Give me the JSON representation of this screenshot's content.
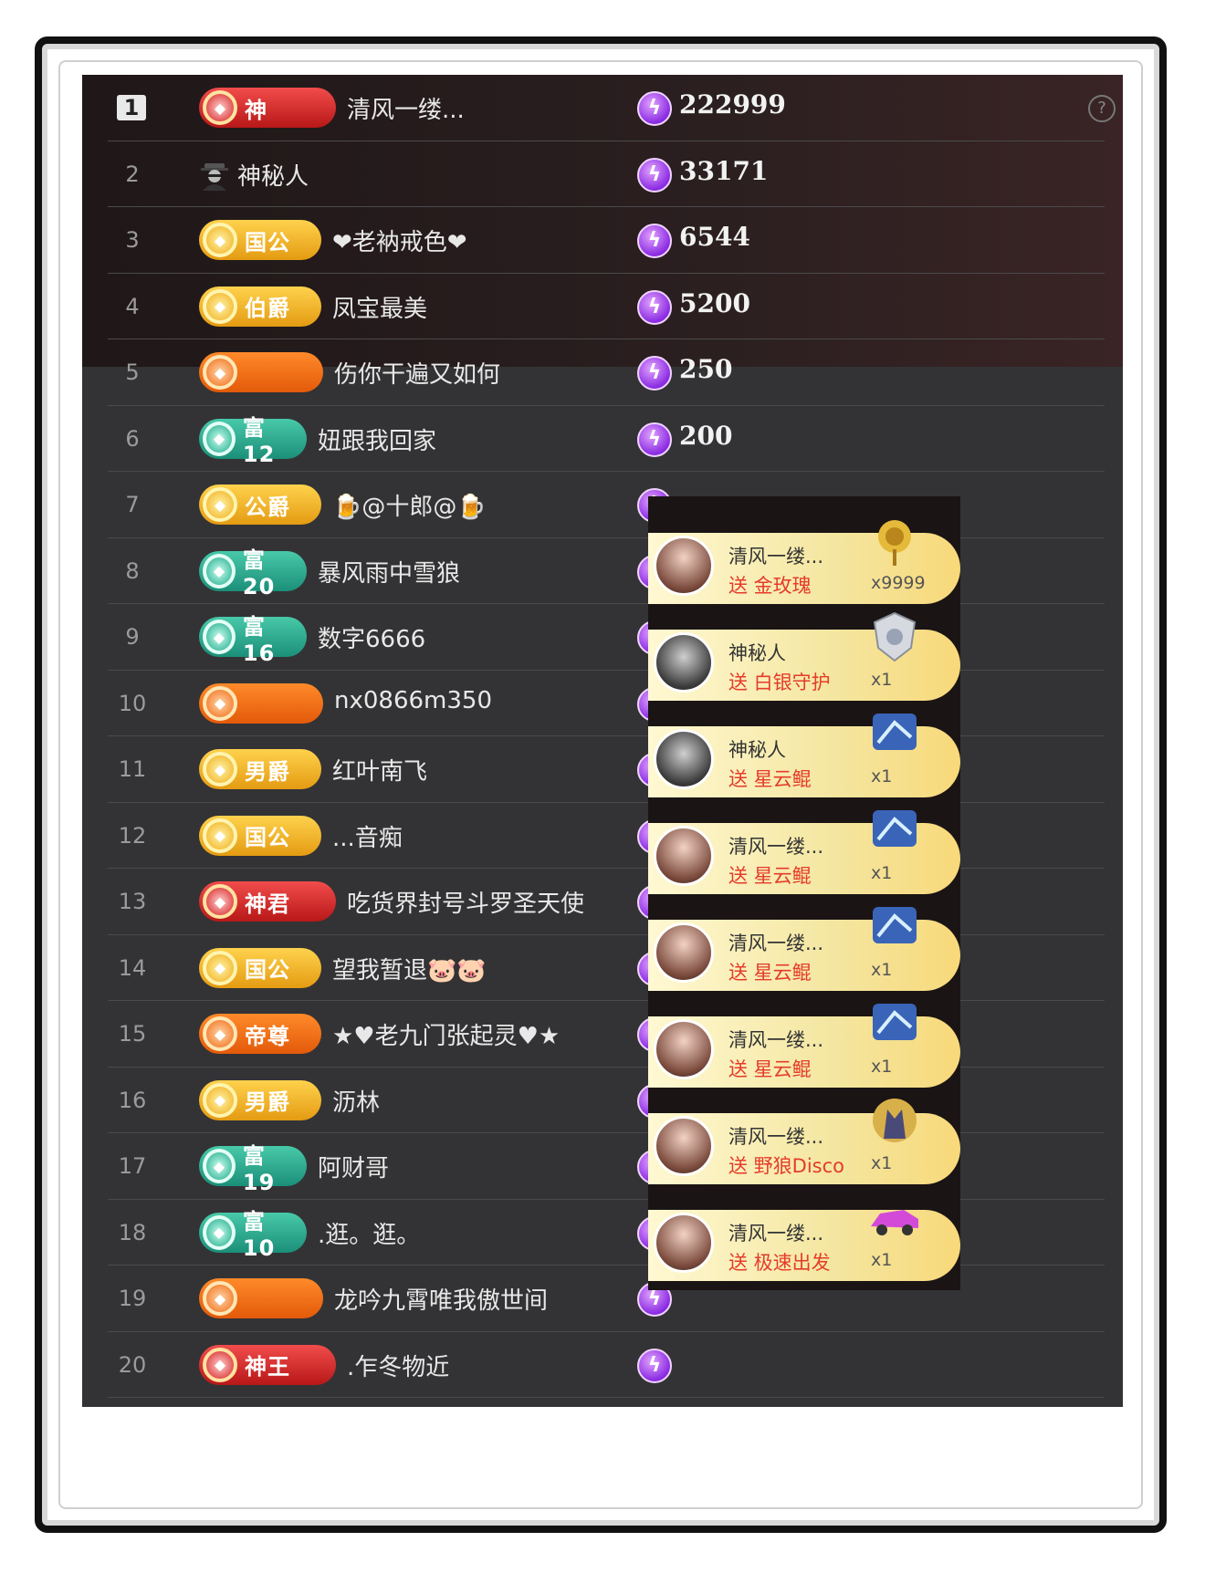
{
  "ranking": [
    {
      "rank": "1",
      "badge": "神",
      "badge_color": "red",
      "name": "清风一缕...",
      "score": "222999"
    },
    {
      "rank": "2",
      "badge": "",
      "badge_color": "none",
      "name": "神秘人",
      "score": "33171",
      "icon": "spy-icon"
    },
    {
      "rank": "3",
      "badge": "国公",
      "badge_color": "gold",
      "name": "❤老衲戒色❤",
      "score": "6544"
    },
    {
      "rank": "4",
      "badge": "伯爵",
      "badge_color": "gold",
      "name": "凤宝最美",
      "score": "5200"
    },
    {
      "rank": "5",
      "badge": "",
      "badge_color": "orange",
      "name": "伤你干遍又如何",
      "score": "250"
    },
    {
      "rank": "6",
      "badge": "富12",
      "badge_color": "teal",
      "name": "妞跟我回家",
      "score": "200"
    },
    {
      "rank": "7",
      "badge": "公爵",
      "badge_color": "gold",
      "name": "🍺@十郎@🍺",
      "score": ""
    },
    {
      "rank": "8",
      "badge": "富20",
      "badge_color": "teal",
      "name": "暴风雨中雪狼",
      "score": ""
    },
    {
      "rank": "9",
      "badge": "富16",
      "badge_color": "teal",
      "name": "数字6666",
      "score": ""
    },
    {
      "rank": "10",
      "badge": "",
      "badge_color": "orange",
      "name": "nx0866m350",
      "score": ""
    },
    {
      "rank": "11",
      "badge": "男爵",
      "badge_color": "gold",
      "name": "红叶南飞",
      "score": ""
    },
    {
      "rank": "12",
      "badge": "国公",
      "badge_color": "gold",
      "name": "...音痴",
      "score": ""
    },
    {
      "rank": "13",
      "badge": "神君",
      "badge_color": "red",
      "name": "吃货界封号斗罗圣天使",
      "score": ""
    },
    {
      "rank": "14",
      "badge": "国公",
      "badge_color": "gold",
      "name": "望我暂退🐷🐷",
      "score": ""
    },
    {
      "rank": "15",
      "badge": "帝尊",
      "badge_color": "orange",
      "name": "★♥老九门张起灵♥★",
      "score": ""
    },
    {
      "rank": "16",
      "badge": "男爵",
      "badge_color": "gold",
      "name": "沥林",
      "score": ""
    },
    {
      "rank": "17",
      "badge": "富19",
      "badge_color": "teal",
      "name": "阿财哥",
      "score": ""
    },
    {
      "rank": "18",
      "badge": "富10",
      "badge_color": "teal",
      "name": ".逛。逛。",
      "score": ""
    },
    {
      "rank": "19",
      "badge": "",
      "badge_color": "orange",
      "name": "龙吟九霄唯我傲世间",
      "score": ""
    },
    {
      "rank": "20",
      "badge": "神王",
      "badge_color": "red",
      "name": ".乍冬物近",
      "score": ""
    }
  ],
  "gifts": [
    {
      "user": "清风一缕...",
      "action": "送 金玫瑰",
      "count": "x9999",
      "avatar": "girl",
      "icon": "gold-rose-icon"
    },
    {
      "user": "神秘人",
      "action": "送 白银守护",
      "count": "x1",
      "avatar": "spy",
      "icon": "silver-shield-icon"
    },
    {
      "user": "神秘人",
      "action": "送 星云鲲",
      "count": "x1",
      "avatar": "spy",
      "icon": "nebula-whale-icon"
    },
    {
      "user": "清风一缕...",
      "action": "送 星云鲲",
      "count": "x1",
      "avatar": "girl",
      "icon": "nebula-whale-icon"
    },
    {
      "user": "清风一缕...",
      "action": "送 星云鲲",
      "count": "x1",
      "avatar": "girl",
      "icon": "nebula-whale-icon"
    },
    {
      "user": "清风一缕...",
      "action": "送 星云鲲",
      "count": "x1",
      "avatar": "girl",
      "icon": "nebula-whale-icon"
    },
    {
      "user": "清风一缕...",
      "action": "送 野狼Disco",
      "count": "x1",
      "avatar": "girl",
      "icon": "wolf-icon"
    },
    {
      "user": "清风一缕...",
      "action": "送 极速出发",
      "count": "x1",
      "avatar": "girl",
      "icon": "sports-car-icon"
    }
  ]
}
